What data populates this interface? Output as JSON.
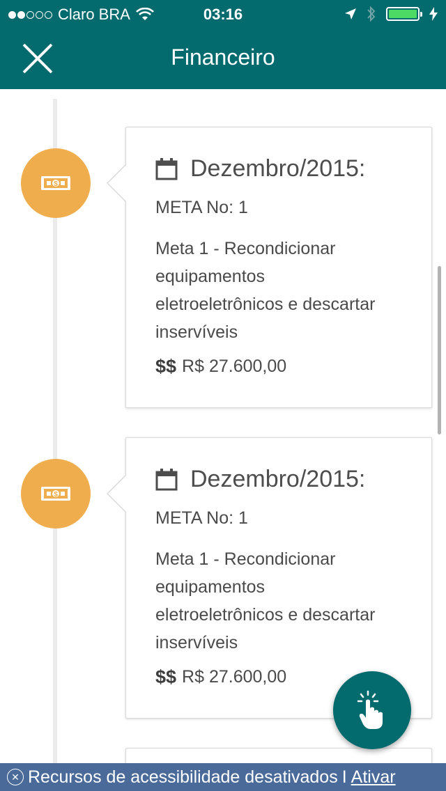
{
  "status_bar": {
    "carrier": "Claro BRA",
    "time": "03:16",
    "signal_dots_filled": 2,
    "signal_dots_total": 5,
    "battery_level": 1.0,
    "colors": {
      "battery": "#4cd964"
    }
  },
  "nav": {
    "title": "Financeiro",
    "close_icon": "close-icon"
  },
  "timeline": {
    "items": [
      {
        "icon": "money-icon",
        "date_icon": "calendar-icon",
        "date": "Dezembro/2015:",
        "meta": "META No: 1",
        "description_lines": [
          "Meta 1 - Recondicionar",
          "equipamentos",
          "eletroeletrônicos e descartar",
          "inservíveis"
        ],
        "currency_symbol": "$$",
        "value": "R$ 27.600,00"
      },
      {
        "icon": "money-icon",
        "date_icon": "calendar-icon",
        "date": "Dezembro/2015:",
        "meta": "META No: 1",
        "description_lines": [
          "Meta 1 - Recondicionar",
          "equipamentos",
          "eletroeletrônicos e descartar",
          "inservíveis"
        ],
        "currency_symbol": "$$",
        "value": "R$ 27.600,00"
      }
    ]
  },
  "fab": {
    "icon": "tap-hand-icon"
  },
  "accessibility_bar": {
    "message": "Recursos de acessibilidade desativados",
    "separator": "I",
    "action": "Ativar"
  },
  "colors": {
    "primary": "#036a6e",
    "icon_circle": "#f0ad4e",
    "accessibility_bar": "#4a6a9a"
  }
}
